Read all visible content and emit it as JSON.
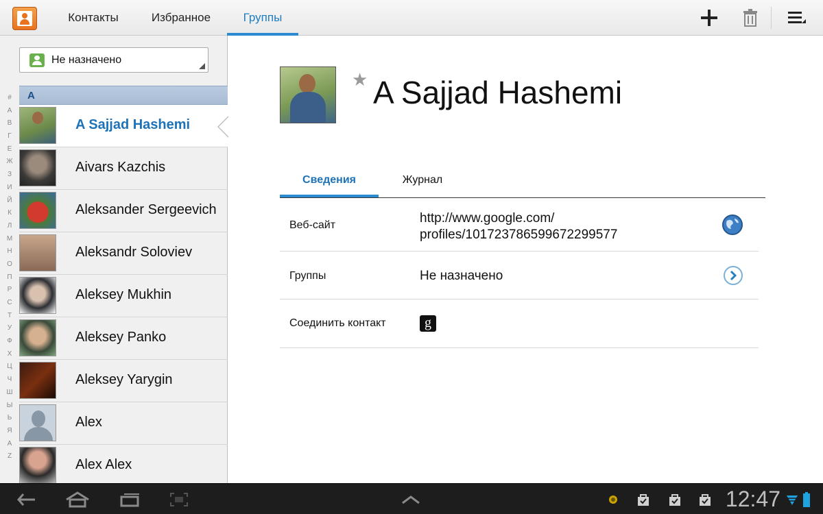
{
  "topbar": {
    "tabs": [
      {
        "label": "Контакты"
      },
      {
        "label": "Избранное"
      },
      {
        "label": "Группы"
      }
    ],
    "active_tab": "Группы",
    "actions": [
      "add-icon",
      "trash-icon",
      "menu-icon"
    ]
  },
  "sidebar": {
    "group_selector": {
      "value": "Не назначено"
    },
    "index_letters": [
      "#",
      "А",
      "В",
      "Г",
      "Е",
      "Ж",
      "З",
      "И",
      "Й",
      "К",
      "Л",
      "М",
      "Н",
      "О",
      "П",
      "Р",
      "С",
      "Т",
      "У",
      "Ф",
      "Х",
      "Ц",
      "Ч",
      "Ш",
      "Ы",
      "Ь",
      "Я",
      "A",
      "Z"
    ],
    "section_header": "A",
    "contacts": [
      {
        "name": "A Sajjad Hashemi"
      },
      {
        "name": "Aivars Kazchis"
      },
      {
        "name": "Aleksander Sergeevich"
      },
      {
        "name": "Aleksandr Soloviev"
      },
      {
        "name": "Aleksey Mukhin"
      },
      {
        "name": "Aleksey Panko"
      },
      {
        "name": "Aleksey Yarygin"
      },
      {
        "name": "Alex"
      },
      {
        "name": "Alex Alex"
      }
    ],
    "selected_contact": "A Sajjad Hashemi"
  },
  "detail": {
    "name": "A Sajjad Hashemi",
    "favorite_icon": "star-icon",
    "tabs": [
      {
        "label": "Сведения"
      },
      {
        "label": "Журнал"
      }
    ],
    "active_tab": "Сведения",
    "rows": [
      {
        "label": "Веб-сайт",
        "value_line1": "http://www.google.com/",
        "value_line2": "profiles/101723786599672299577",
        "icon": "globe-icon"
      },
      {
        "label": "Группы",
        "value": "Не назначено",
        "icon": "chevron-right-icon"
      },
      {
        "label": "Соединить контакт",
        "icon": "google-icon",
        "icon_text": "g"
      }
    ]
  },
  "sysbar": {
    "time": "12:47",
    "accent": "#1fa3e0"
  }
}
